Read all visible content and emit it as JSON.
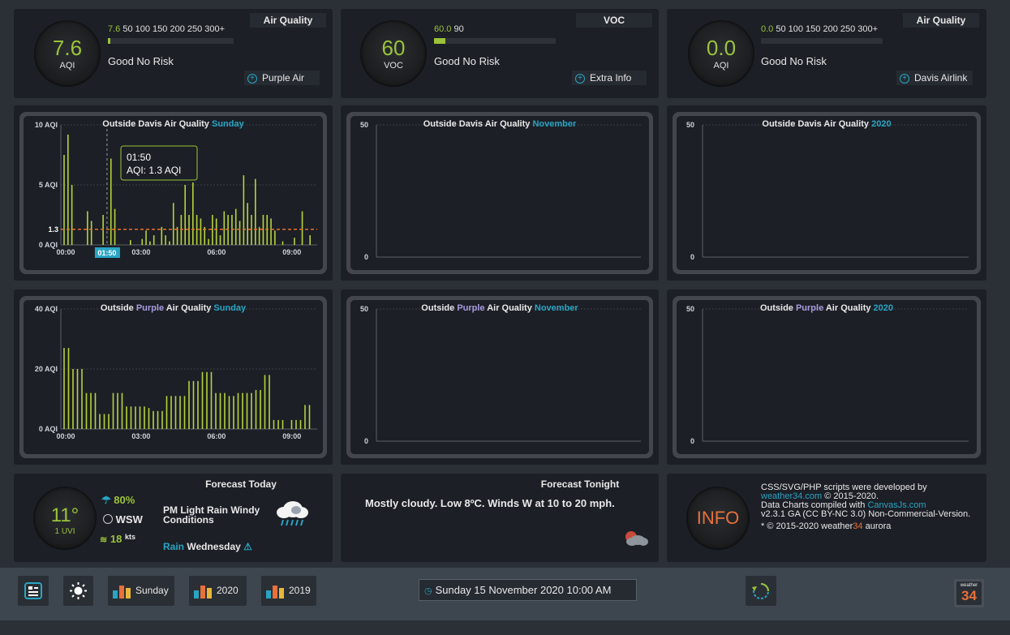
{
  "top_panels": [
    {
      "value": "7.6",
      "unit": "AQI",
      "scale_hl": "7.6",
      "scale_rest": " 50 100 150 200 250 300+",
      "fill_fraction": 0.01,
      "status": "Good No Risk",
      "tag": "Air Quality",
      "link": "Purple Air"
    },
    {
      "value": "60",
      "unit": "VOC",
      "scale_hl": "60.0",
      "scale_rest": " 90",
      "fill_fraction": 0.09,
      "status": "Good No Risk",
      "tag": "VOC",
      "link": "Extra Info"
    },
    {
      "value": "0.0",
      "unit": "AQI",
      "scale_hl": "0.0",
      "scale_rest": " 50 100 150 200 250 300+",
      "fill_fraction": 0.0,
      "status": "Good No Risk",
      "tag": "Air Quality",
      "link": "Davis Airlink"
    }
  ],
  "charts": {
    "davis_day": {
      "title_pre": "Outside Davis Air Quality",
      "period": "Sunday",
      "y_ticks": [
        "10 AQI",
        "5 AQI",
        "0 AQI"
      ],
      "x_ticks": [
        "00:00",
        "03:00",
        "06:00",
        "09:00"
      ],
      "tooltip_time": "01:50",
      "tooltip_value": "AQI:  1.3 AQI",
      "avg_label": "1.3",
      "cursor_label": "01:50"
    },
    "davis_month": {
      "title_pre": "Outside Davis Air Quality",
      "period": "November",
      "y_ticks": [
        "50",
        "0"
      ]
    },
    "davis_year": {
      "title_pre": "Outside Davis Air Quality",
      "period": "2020",
      "y_ticks": [
        "50",
        "0"
      ]
    },
    "purple_day": {
      "title_a": "Outside ",
      "title_b": "Purple",
      "title_c": " Air Quality",
      "period": "Sunday",
      "y_ticks": [
        "40 AQI",
        "20 AQI",
        "0 AQI"
      ],
      "x_ticks": [
        "00:00",
        "03:00",
        "06:00",
        "09:00"
      ]
    },
    "purple_month": {
      "title_a": "Outside ",
      "title_b": "Purple",
      "title_c": " Air Quality",
      "period": "November",
      "y_ticks": [
        "50",
        "0"
      ]
    },
    "purple_year": {
      "title_a": "Outside ",
      "title_b": "Purple",
      "title_c": " Air Quality",
      "period": "2020",
      "y_ticks": [
        "50",
        "0"
      ]
    }
  },
  "chart_data": [
    {
      "type": "bar",
      "title": "Outside Davis Air Quality Sunday",
      "ylim": [
        0,
        10
      ],
      "x_range": [
        "00:00",
        "10:00"
      ],
      "values": [
        7.5,
        9.2,
        5,
        0,
        0,
        0,
        2.8,
        2,
        0,
        0,
        2.5,
        0,
        7.2,
        3,
        0,
        0,
        0,
        0.4,
        0,
        0,
        0.5,
        1.2,
        0.3,
        0.8,
        0,
        1.5,
        0.8,
        0.3,
        3.5,
        1.5,
        2.5,
        5,
        2.5,
        5.2,
        2.5,
        2.2,
        1.5,
        0.5,
        2.5,
        2.2,
        0.8,
        2.8,
        2.5,
        2.5,
        3,
        2,
        5.8,
        3.5,
        2.5,
        5.5,
        1.5,
        2.5,
        2.5,
        2.2,
        1.2,
        0,
        0.3,
        0,
        0,
        0.6,
        0,
        2.8,
        0,
        0.8
      ],
      "series_name": "AQI",
      "avg_line": 1.3
    },
    {
      "type": "bar",
      "title": "Outside Purple Air Quality Sunday",
      "ylim": [
        0,
        40
      ],
      "x_range": [
        "00:00",
        "10:00"
      ],
      "values": [
        27,
        27,
        20,
        20,
        20,
        12,
        12,
        12,
        5,
        5,
        5,
        12,
        12,
        12,
        7.5,
        7.5,
        7.5,
        7.5,
        7.5,
        7,
        6,
        6,
        6,
        11,
        11,
        11,
        11,
        11,
        16,
        16,
        16,
        19,
        19,
        19,
        12,
        12,
        12,
        11,
        11,
        12,
        12,
        12,
        12,
        13,
        13,
        18,
        18,
        3,
        3,
        3,
        0,
        3,
        3,
        3,
        8,
        8
      ]
    },
    {
      "type": "line",
      "title": "Outside Davis Air Quality November",
      "ylim": [
        0,
        50
      ],
      "values": []
    },
    {
      "type": "line",
      "title": "Outside Davis Air Quality 2020",
      "ylim": [
        0,
        50
      ],
      "values": []
    },
    {
      "type": "line",
      "title": "Outside Purple Air Quality November",
      "ylim": [
        0,
        50
      ],
      "values": []
    },
    {
      "type": "line",
      "title": "Outside Purple Air Quality 2020",
      "ylim": [
        0,
        50
      ],
      "values": []
    }
  ],
  "forecast_today": {
    "title": "Forecast Today",
    "temp": "11°",
    "uvi": "1 UVI",
    "humidity": "80%",
    "wind_dir": "WSW",
    "wind_speed": "18",
    "wind_unit": "kts",
    "summary": "PM Light Rain Windy Conditions",
    "rain_label": "Rain",
    "rain_day": "Wednesday"
  },
  "forecast_tonight": {
    "title": "Forecast Tonight",
    "text": "Mostly cloudy. Low 8ºC. Winds W at 10 to 20 mph."
  },
  "info": {
    "badge": "INFO",
    "line1": "CSS/SVG/PHP scripts were developed by",
    "link1": "weather34.com",
    "line1b": " © 2015-2020.",
    "line2": "Data Charts compiled with ",
    "link2": "CanvasJs.com",
    "line3": "v2.3.1 GA (CC BY-NC 3.0) Non-Commercial-Version.",
    "line4a": "* © 2015-2020 weather",
    "line4b": "34",
    "line4c": " aurora"
  },
  "footer": {
    "btn_sunday": "Sunday",
    "btn_2020": "2020",
    "btn_2019": "2019",
    "datetime": "Sunday 15 November 2020 10:00 AM",
    "logo_top": "weather",
    "logo_num": "34"
  },
  "colors": {
    "accent_green": "#9bc33a",
    "accent_cyan": "#28a5c4",
    "purple": "#a89be0",
    "info_orange": "#e8703a",
    "avg_line": "#e8702a"
  }
}
